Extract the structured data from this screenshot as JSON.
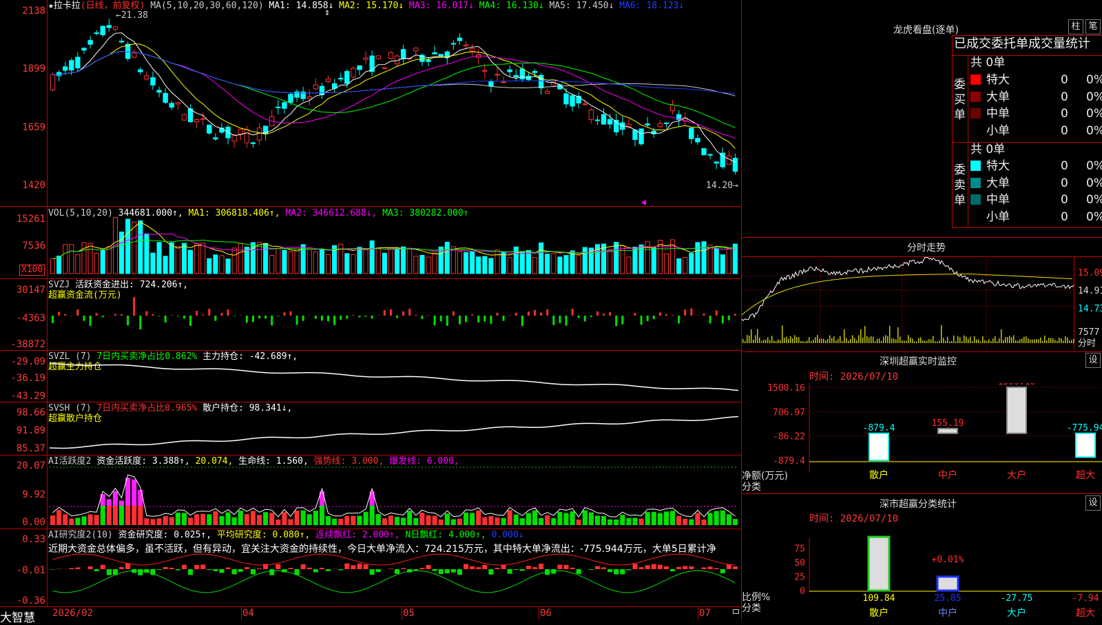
{
  "colors": {
    "up": "#ff3030",
    "down": "#00ffff",
    "ma1": "#ffffff",
    "ma2": "#ffff00",
    "ma3": "#ff00ff",
    "ma4": "#00ff00",
    "ma5": "#cccccc",
    "ma6": "#2040ff"
  },
  "main": {
    "y_ticks": [
      "2138",
      "1899",
      "1659",
      "1420"
    ],
    "hdr": {
      "name": "★拉卡拉",
      "period": "(日线，前复权)",
      "ma_label": "MA(5,10,20,30,60,120)",
      "ma1": "MA1: 14.858↓",
      "ma2": "MA2: 15.170↓",
      "ma3": "MA3: 16.017↓",
      "ma4": "MA4: 16.130↓",
      "ma5": "MA5: 17.450↓",
      "ma6": "MA6: 18.123↓"
    },
    "high_label": "←21.38",
    "low_label": "14.20→"
  },
  "vol": {
    "y_ticks": [
      "15261",
      "7536"
    ],
    "unit": "X100",
    "hdr": {
      "label": "VOL(5,10,20)",
      "value": "344681.000↑,",
      "ma1": "MA1: 306818.406↑,",
      "ma2": "MA2: 346612.688↓,",
      "ma3": "MA3: 380282.000↑"
    }
  },
  "svzj": {
    "y_ticks": [
      "30147",
      "-4363",
      "-38872"
    ],
    "hdr": {
      "label": "SVZJ",
      "text": "活跃资金进出: 724.206↑,"
    },
    "sub": "超赢资金流(万元)"
  },
  "svzl": {
    "y_ticks": [
      "-29.09",
      "-36.19",
      "-43.29"
    ],
    "hdr": {
      "label": "SVZL (7)",
      "ratio": "7日内买卖净占比0.862%",
      "text": "主力持仓: -42.689↑,"
    },
    "sub": "超赢主力持仓"
  },
  "svsh": {
    "y_ticks": [
      "98.66",
      "91.89",
      "85.37"
    ],
    "hdr": {
      "label": "SVSH (7)",
      "ratio": "7日内买卖净占比0.965%",
      "text": "散户持仓: 98.341↓,"
    },
    "sub": "超赢散户持仓"
  },
  "ai1": {
    "y_ticks": [
      "20.07",
      "9.92",
      "0.00"
    ],
    "hdr": {
      "label": "AI活跃度2",
      "a": "资金活跃度: 3.388↑,",
      "b": "20.074,",
      "c": "生命线: 1.560,",
      "d": "强势线: 3.000,",
      "e": "爆发线: 6.000,"
    }
  },
  "ai2": {
    "y_ticks": [
      "0.33",
      "-0.01",
      "-0.36"
    ],
    "hdr": {
      "label": "AI研究度2(10)",
      "a": "资金研究度: 0.025↑,",
      "b": "平均研究度: 0.080↑,",
      "c": "连续飘红: 2.000↑,",
      "d": "N日飘红: 4.000↑,",
      "e": "0.000↓"
    },
    "comment": "近期大资金总体偏多，虽不活跃，但有异动，宜关注大资金的持续性，今日大单净流入：724.215万元，其中特大单净流出：-775.944万元，大单5日累计净"
  },
  "dates": [
    "2026/02",
    "04",
    "05",
    "06",
    "07"
  ],
  "brand": "大智慧",
  "longhu": {
    "title": "龙虎看盘(逐单)",
    "btn1": "柱",
    "btn2": "笔",
    "subtitle": "已成交委托单成交量统计",
    "buy_label": "委买单",
    "sell_label": "委卖单",
    "buy_total": "共 0单",
    "sell_total": "共 0单",
    "buy_rows": [
      {
        "label": "特大",
        "count": "0",
        "pct": "0%",
        "color": "#ff0000"
      },
      {
        "label": "大单",
        "count": "0",
        "pct": "0%",
        "color": "#8b0000"
      },
      {
        "label": "中单",
        "count": "0",
        "pct": "0%",
        "color": "#6a0000"
      },
      {
        "label": "小单",
        "count": "0",
        "pct": "0%",
        "color": ""
      }
    ],
    "sell_rows": [
      {
        "label": "特大",
        "count": "0",
        "pct": "0%",
        "color": "#00ffff"
      },
      {
        "label": "大单",
        "count": "0",
        "pct": "0%",
        "color": "#008b8b"
      },
      {
        "label": "中单",
        "count": "0",
        "pct": "0%",
        "color": "#006b6b"
      },
      {
        "label": "小单",
        "count": "0",
        "pct": "0%",
        "color": ""
      }
    ]
  },
  "intraday": {
    "title": "分时走势",
    "y_ticks": [
      "15.09",
      "14.91",
      "14.73"
    ],
    "vol_tick": "7577",
    "vol_label": "分时"
  },
  "monitor": {
    "title": "深圳超赢实时监控",
    "btn": "设",
    "time": "时间: 2026/07/10",
    "y_ticks": [
      "1500.16",
      "706.97",
      "-86.22",
      "-879.4"
    ],
    "axis_label1": "净额(万元)",
    "axis_label2": "分类",
    "bars": [
      {
        "label": "散户",
        "value": -879.4,
        "text": "-879.4"
      },
      {
        "label": "中户",
        "value": 155.19,
        "text": "155.19"
      },
      {
        "label": "大户",
        "value": 1500.16,
        "text": "1500.16"
      },
      {
        "label": "超大",
        "value": -775.94,
        "text": "-775.94"
      }
    ]
  },
  "stats": {
    "title": "深市超赢分类统计",
    "btn": "设",
    "time": "时间: 2026/07/10",
    "y_ticks": [
      "75",
      "50",
      "25",
      "0"
    ],
    "axis_label1": "比例%",
    "axis_label2": "分类",
    "annotation": "+0.01%",
    "bars": [
      {
        "label": "散户",
        "value": 109.84,
        "text": "109.84"
      },
      {
        "label": "中户",
        "value": 25.85,
        "text": "25.85"
      },
      {
        "label": "大户",
        "value": -27.75,
        "text": "-27.75"
      },
      {
        "label": "超大",
        "value": -7.94,
        "text": "-7.94"
      }
    ]
  }
}
